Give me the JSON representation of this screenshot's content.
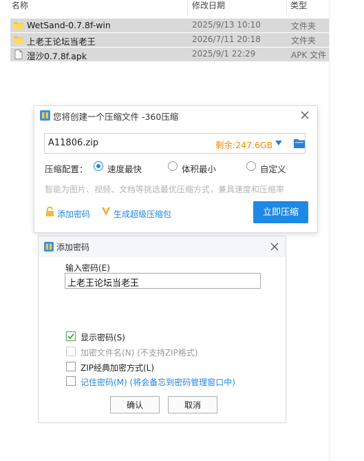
{
  "explorer": {
    "columns": {
      "name": "名称",
      "date": "修改日期",
      "type": "类型"
    },
    "rows": [
      {
        "name": "WetSand-0.7.8f-win",
        "date": "2025/9/13 10:10",
        "type": "文件夹",
        "icon": "folder-icon",
        "selected": true
      },
      {
        "name": "上老王论坛当老王",
        "date": "2026/7/11 20:18",
        "type": "文件夹",
        "icon": "folder-icon",
        "selected": true
      },
      {
        "name": "湿沙0.7.8f.apk",
        "date": "2025/9/1 22:29",
        "type": "APK 文件",
        "icon": "file-icon",
        "selected": true
      }
    ]
  },
  "compress_dialog": {
    "title": "您将创建一个压缩文件 -360压缩",
    "filename": "A11806.zip",
    "free_space": "剩余:247.6GB",
    "config_label": "压缩配置：",
    "options": [
      {
        "label": "速度最快",
        "checked": true
      },
      {
        "label": "体积最小",
        "checked": false
      },
      {
        "label": "自定义",
        "checked": false
      }
    ],
    "hint": "智能为图片、视频、文档等挑选最优压缩方式，兼具速度和压缩率",
    "add_password_link": "添加密码",
    "super_package_link": "生成超级压缩包",
    "compress_button": "立即压缩",
    "accent_color": "#1e88e5",
    "free_space_color": "#f08a00"
  },
  "password_dialog": {
    "title": "添加密码",
    "input_label": "输入密码(E)",
    "password_value": "上老王论坛当老王",
    "checkboxes": [
      {
        "label": "显示密码(S)",
        "checked": true,
        "disabled": false
      },
      {
        "label": "加密文件名(N) (不支持ZIP格式)",
        "checked": false,
        "disabled": true
      },
      {
        "label": "ZIP经典加密方式(L)",
        "checked": false,
        "disabled": false
      },
      {
        "label": "记住密码(M) (将会备忘到密码管理窗口中)",
        "checked": false,
        "disabled": false
      }
    ],
    "ok_button": "确认",
    "cancel_button": "取消"
  }
}
